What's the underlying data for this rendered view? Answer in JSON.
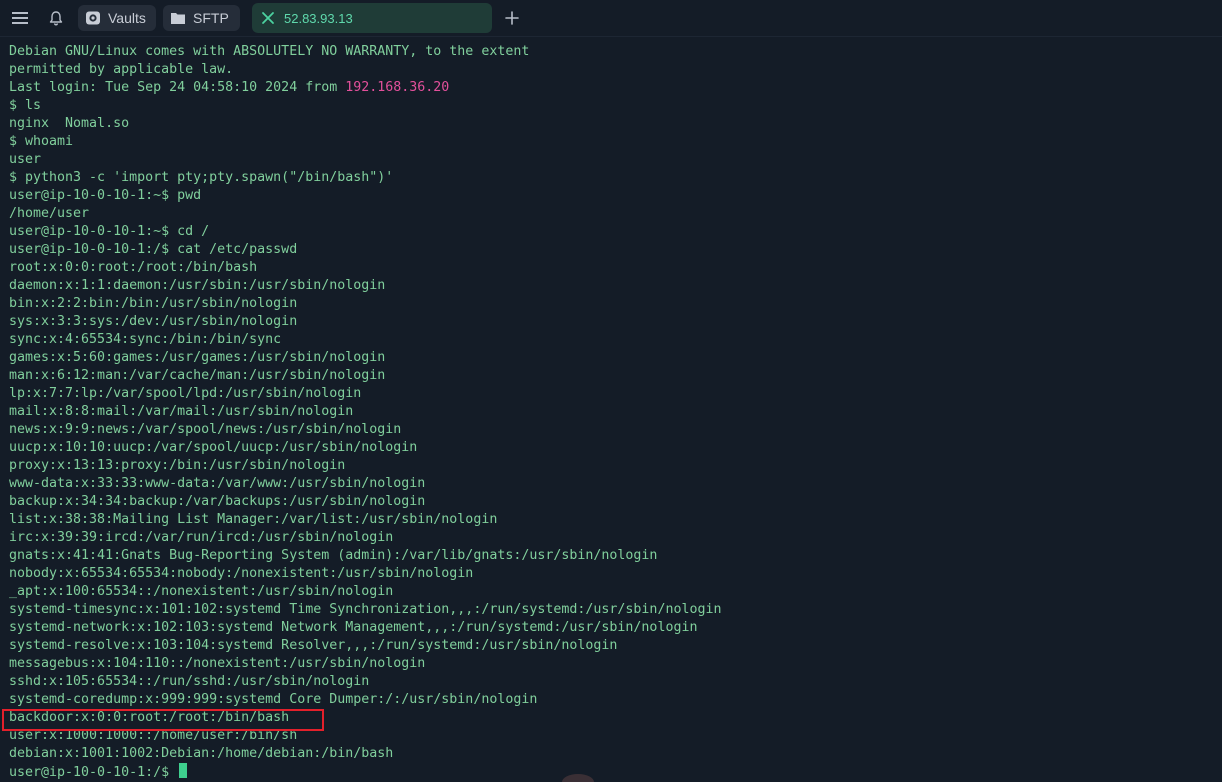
{
  "toolbar": {
    "vaults_label": "Vaults",
    "sftp_label": "SFTP"
  },
  "tab": {
    "host": "52.83.93.13"
  },
  "terminal": {
    "motd_1": "Debian GNU/Linux comes with ABSOLUTELY NO WARRANTY, to the extent",
    "motd_2": "permitted by applicable law.",
    "last_login_prefix": "Last login: Tue Sep 24 04:58:10 2024 from ",
    "last_login_ip": "192.168.36.20",
    "lines": [
      "$ ls",
      "nginx  Nomal.so",
      "$ whoami",
      "user",
      "$ python3 -c 'import pty;pty.spawn(\"/bin/bash\")'",
      "user@ip-10-0-10-1:~$ pwd",
      "/home/user",
      "user@ip-10-0-10-1:~$ cd /",
      "user@ip-10-0-10-1:/$ cat /etc/passwd",
      "root:x:0:0:root:/root:/bin/bash",
      "daemon:x:1:1:daemon:/usr/sbin:/usr/sbin/nologin",
      "bin:x:2:2:bin:/bin:/usr/sbin/nologin",
      "sys:x:3:3:sys:/dev:/usr/sbin/nologin",
      "sync:x:4:65534:sync:/bin:/bin/sync",
      "games:x:5:60:games:/usr/games:/usr/sbin/nologin",
      "man:x:6:12:man:/var/cache/man:/usr/sbin/nologin",
      "lp:x:7:7:lp:/var/spool/lpd:/usr/sbin/nologin",
      "mail:x:8:8:mail:/var/mail:/usr/sbin/nologin",
      "news:x:9:9:news:/var/spool/news:/usr/sbin/nologin",
      "uucp:x:10:10:uucp:/var/spool/uucp:/usr/sbin/nologin",
      "proxy:x:13:13:proxy:/bin:/usr/sbin/nologin",
      "www-data:x:33:33:www-data:/var/www:/usr/sbin/nologin",
      "backup:x:34:34:backup:/var/backups:/usr/sbin/nologin",
      "list:x:38:38:Mailing List Manager:/var/list:/usr/sbin/nologin",
      "irc:x:39:39:ircd:/var/run/ircd:/usr/sbin/nologin",
      "gnats:x:41:41:Gnats Bug-Reporting System (admin):/var/lib/gnats:/usr/sbin/nologin",
      "nobody:x:65534:65534:nobody:/nonexistent:/usr/sbin/nologin",
      "_apt:x:100:65534::/nonexistent:/usr/sbin/nologin",
      "systemd-timesync:x:101:102:systemd Time Synchronization,,,:/run/systemd:/usr/sbin/nologin",
      "systemd-network:x:102:103:systemd Network Management,,,:/run/systemd:/usr/sbin/nologin",
      "systemd-resolve:x:103:104:systemd Resolver,,,:/run/systemd:/usr/sbin/nologin",
      "messagebus:x:104:110::/nonexistent:/usr/sbin/nologin",
      "sshd:x:105:65534::/run/sshd:/usr/sbin/nologin",
      "systemd-coredump:x:999:999:systemd Core Dumper:/:/usr/sbin/nologin",
      "backdoor:x:0:0:root:/root:/bin/bash",
      "user:x:1000:1000::/home/user:/bin/sh",
      "debian:x:1001:1002:Debian:/home/debian:/bin/bash"
    ],
    "prompt": "user@ip-10-0-10-1:/$ "
  },
  "colors": {
    "background": "#141c27",
    "terminal_text": "#80cf9c",
    "ip_highlight": "#e2509b",
    "tab_active_bg": "#1f3c37",
    "tab_active_text": "#5fd9ac",
    "annotation_box": "#e3202b"
  },
  "icons": {
    "menu": "hamburger-icon",
    "bell": "bell-icon",
    "vaults": "vault-icon",
    "sftp": "folder-icon",
    "tab_close": "close-icon",
    "new_tab": "plus-icon"
  }
}
